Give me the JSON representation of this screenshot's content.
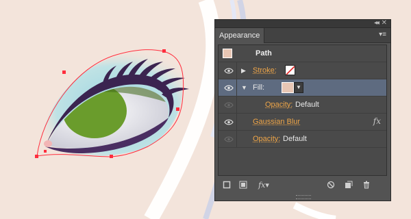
{
  "colors": {
    "skin": "#f3e4db",
    "panel_bg": "#535353",
    "selected_row": "#5e6b80",
    "attribute_label": "#f0a648",
    "iris": "#6a9c2c",
    "eyeshadow": "#9fd6e2",
    "eyeliner": "#3b2450",
    "selection_path": "#ff2d3d"
  },
  "panel": {
    "tab": "Appearance",
    "topbar_icons": [
      "collapse-icon",
      "close-icon"
    ],
    "menu_icon": "panel-menu-icon",
    "rows": {
      "path": {
        "label": "Path"
      },
      "stroke": {
        "label": "Stroke:"
      },
      "fill": {
        "label": "Fill:"
      },
      "fill_opacity": {
        "label": "Opacity:",
        "value": "Default"
      },
      "gaussian_blur": {
        "label": "Gaussian Blur",
        "fx": "fx"
      },
      "opacity": {
        "label": "Opacity:",
        "value": "Default"
      }
    },
    "footer": {
      "fx": "fx"
    }
  }
}
